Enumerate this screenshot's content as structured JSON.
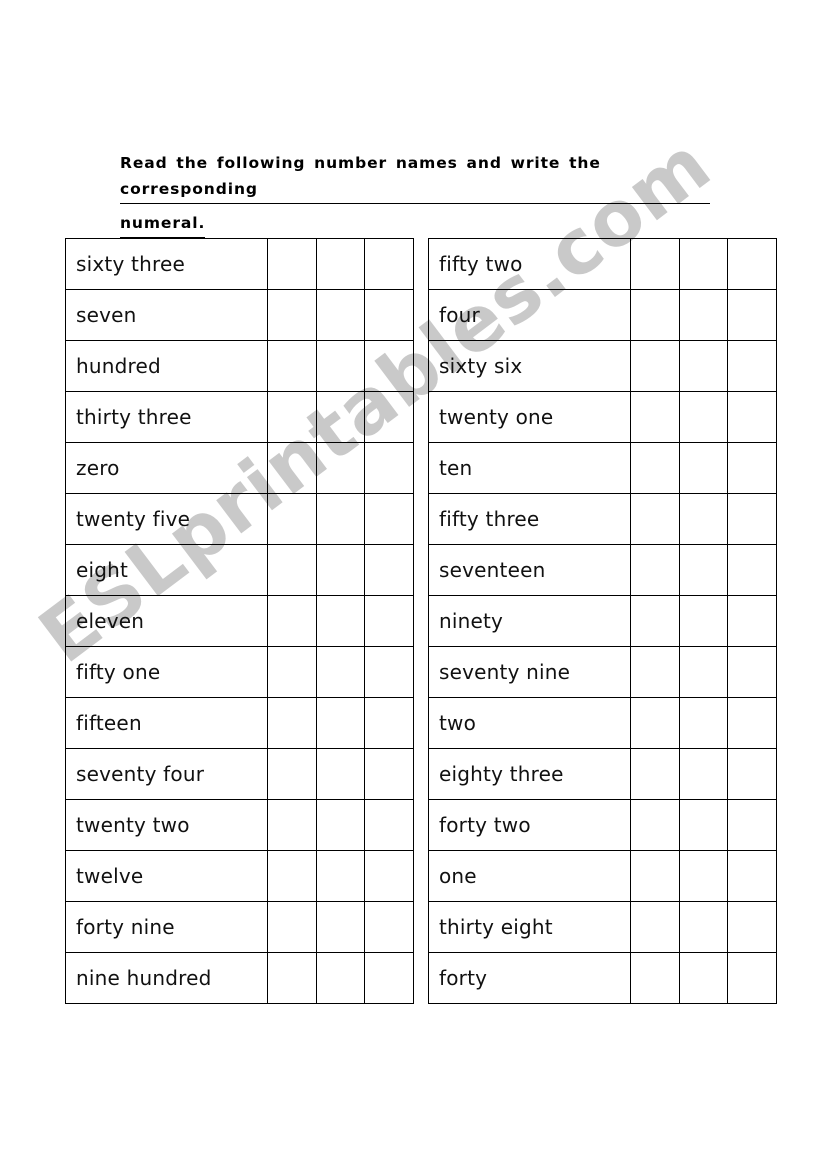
{
  "heading": {
    "line1": "Read the following number names and write the corresponding",
    "line2": "numeral."
  },
  "watermark": {
    "text": "ESLprintables.com",
    "color": "#c9c9c9"
  },
  "table": {
    "answer_columns_per_row": 3,
    "left": {
      "rows": [
        "sixty three",
        "seven",
        "hundred",
        "thirty three",
        "zero",
        "twenty five",
        "eight",
        "eleven",
        "fifty one",
        "fifteen",
        "seventy four",
        "twenty two",
        "twelve",
        "forty nine",
        "nine hundred"
      ]
    },
    "right": {
      "rows": [
        "fifty two",
        "four",
        "sixty six",
        "twenty one",
        "ten",
        "fifty three",
        "seventeen",
        "ninety",
        "seventy nine",
        "two",
        "eighty three",
        "forty two",
        "one",
        "thirty eight",
        "forty"
      ]
    }
  }
}
